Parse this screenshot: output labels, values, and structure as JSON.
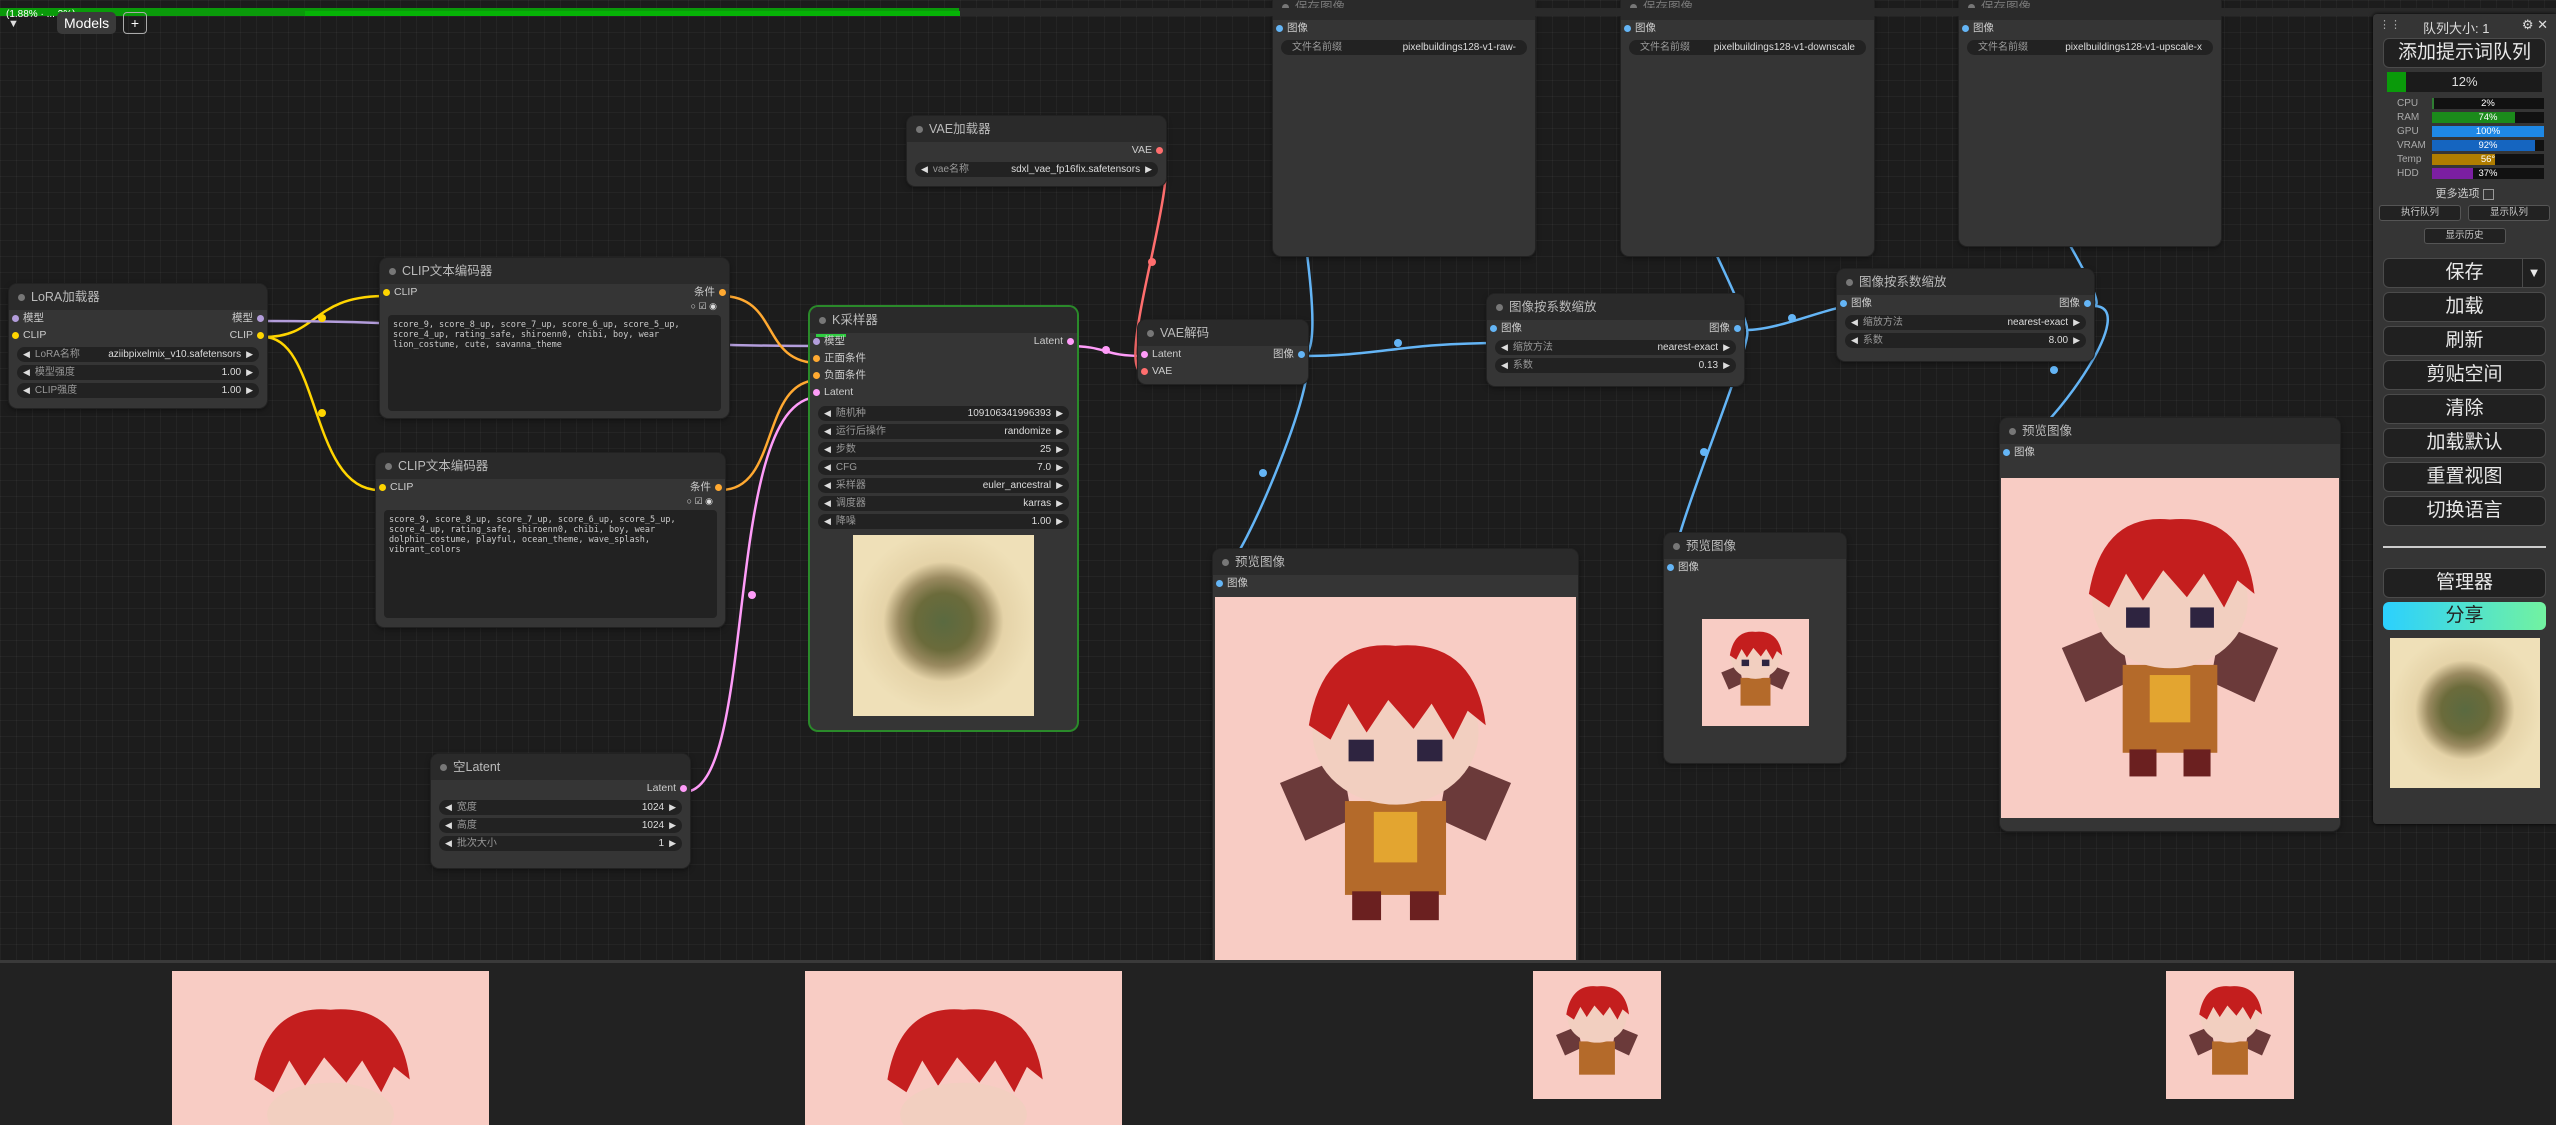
{
  "topbar": {
    "progress_label": "(1.88% · ... 2%)",
    "models_label": "Models",
    "add_icon": "plus-square-icon",
    "progress_fraction": 0.375
  },
  "nodes": {
    "lora": {
      "title": "LoRA加载器",
      "in_model": "模型",
      "in_clip": "CLIP",
      "out_model": "模型",
      "out_clip": "CLIP",
      "w_name_label": "LoRA名称",
      "w_name_value": "aziibpixelmix_v10.safetensors",
      "w_model_strength_label": "模型强度",
      "w_model_strength_value": "1.00",
      "w_clip_strength_label": "CLIP强度",
      "w_clip_strength_value": "1.00"
    },
    "clip_pos": {
      "title": "CLIP文本编码器",
      "in_clip": "CLIP",
      "out_cond": "条件",
      "text": "score_9, score_8_up, score_7_up, score_6_up, score_5_up, score_4_up, rating_safe, shiroenn0, chibi, boy, wear lion_costume, cute, savanna_theme"
    },
    "clip_neg": {
      "title": "CLIP文本编码器",
      "in_clip": "CLIP",
      "out_cond": "条件",
      "text": "score_9, score_8_up, score_7_up, score_6_up, score_5_up, score_4_up, rating_safe, shiroenn0, chibi, boy, wear dolphin_costume, playful, ocean_theme, wave_splash, vibrant_colors"
    },
    "vae_loader": {
      "title": "VAE加载器",
      "out_vae": "VAE",
      "w_label": "vae名称",
      "w_value": "sdxl_vae_fp16fix.safetensors"
    },
    "ksampler": {
      "title": "K采样器",
      "in_model": "模型",
      "in_pos": "正面条件",
      "in_neg": "负面条件",
      "in_latent": "Latent",
      "out_latent": "Latent",
      "widgets": [
        {
          "label": "随机种",
          "value": "109106341996393"
        },
        {
          "label": "运行后操作",
          "value": "randomize"
        },
        {
          "label": "步数",
          "value": "25"
        },
        {
          "label": "CFG",
          "value": "7.0"
        },
        {
          "label": "采样器",
          "value": "euler_ancestral"
        },
        {
          "label": "调度器",
          "value": "karras"
        },
        {
          "label": "降噪",
          "value": "1.00"
        }
      ]
    },
    "empty_latent": {
      "title": "空Latent",
      "out_latent": "Latent",
      "widgets": [
        {
          "label": "宽度",
          "value": "1024"
        },
        {
          "label": "高度",
          "value": "1024"
        },
        {
          "label": "批次大小",
          "value": "1"
        }
      ]
    },
    "vae_decode": {
      "title": "VAE解码",
      "in_latent": "Latent",
      "in_vae": "VAE",
      "out_image": "图像"
    },
    "save1": {
      "title": "保存图像",
      "in_image": "图像",
      "w_label": "文件名前缀",
      "w_value": "pixelbuildings128-v1-raw-"
    },
    "save2": {
      "title": "保存图像",
      "in_image": "图像",
      "w_label": "文件名前缀",
      "w_value": "pixelbuildings128-v1-downscale"
    },
    "save3": {
      "title": "保存图像",
      "in_image": "图像",
      "w_label": "文件名前缀",
      "w_value": "pixelbuildings128-v1-upscale-x"
    },
    "scale1": {
      "title": "图像按系数缩放",
      "in_image": "图像",
      "out_image": "图像",
      "widgets": [
        {
          "label": "缩放方法",
          "value": "nearest-exact"
        },
        {
          "label": "系数",
          "value": "0.13"
        }
      ]
    },
    "scale2": {
      "title": "图像按系数缩放",
      "in_image": "图像",
      "out_image": "图像",
      "widgets": [
        {
          "label": "缩放方法",
          "value": "nearest-exact"
        },
        {
          "label": "系数",
          "value": "8.00"
        }
      ]
    },
    "preview1": {
      "title": "预览图像",
      "in_image": "图像"
    },
    "preview2": {
      "title": "预览图像",
      "in_image": "图像"
    },
    "preview3": {
      "title": "预览图像",
      "in_image": "图像"
    }
  },
  "panel": {
    "queue_size": "队列大小: 1",
    "queue_button": "添加提示词队列",
    "progress": "12%",
    "progress_fraction": 0.12,
    "stats": [
      {
        "label": "CPU",
        "value": "2%",
        "fraction": 0.02,
        "color": "#2e7d32"
      },
      {
        "label": "RAM",
        "value": "74%",
        "fraction": 0.74,
        "color": "#1b8a1b"
      },
      {
        "label": "GPU",
        "value": "100%",
        "fraction": 1.0,
        "color": "#1e88e5"
      },
      {
        "label": "VRAM",
        "value": "92%",
        "fraction": 0.92,
        "color": "#1565c0"
      },
      {
        "label": "Temp",
        "value": "56°",
        "fraction": 0.56,
        "color": "#b07d00"
      },
      {
        "label": "HDD",
        "value": "37%",
        "fraction": 0.37,
        "color": "#7b1fa2"
      }
    ],
    "extra_options": "更多选项",
    "view_queue": "执行队列",
    "view_history_queue": "显示队列",
    "view_history": "显示历史",
    "buttons": [
      "保存",
      "加载",
      "刷新",
      "剪贴空间",
      "清除",
      "加载默认",
      "重置视图",
      "切换语言"
    ],
    "manager": "管理器",
    "share": "分享"
  }
}
